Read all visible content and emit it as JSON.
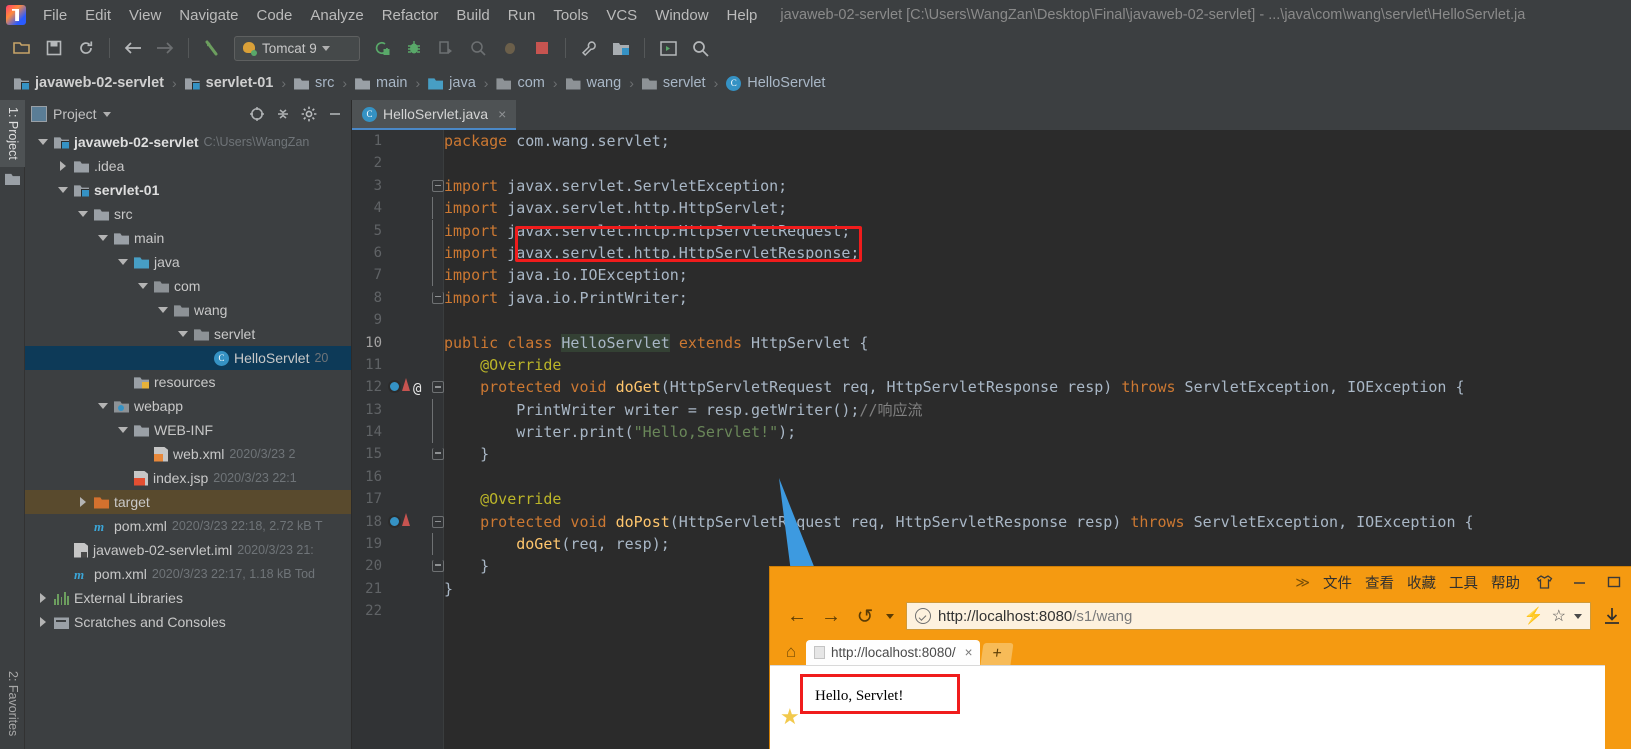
{
  "window": {
    "title": "javaweb-02-servlet [C:\\Users\\WangZan\\Desktop\\Final\\javaweb-02-servlet] - ...\\java\\com\\wang\\servlet\\HelloServlet.ja"
  },
  "menubar": {
    "items": [
      "File",
      "Edit",
      "View",
      "Navigate",
      "Code",
      "Analyze",
      "Refactor",
      "Build",
      "Run",
      "Tools",
      "VCS",
      "Window",
      "Help"
    ]
  },
  "toolbar": {
    "run_config": "Tomcat 9",
    "buttons": [
      "open-folder",
      "save-all",
      "sync",
      "back",
      "forward",
      "revert",
      "run",
      "debug",
      "run-with-coverage",
      "profile",
      "attach",
      "stop",
      "settings",
      "project-structure",
      "update",
      "search"
    ]
  },
  "breadcrumbs": [
    {
      "label": "javaweb-02-servlet",
      "icon": "module-icon",
      "bold": true
    },
    {
      "label": "servlet-01",
      "icon": "module-icon",
      "bold": true
    },
    {
      "label": "src",
      "icon": "folder-icon",
      "bold": false
    },
    {
      "label": "main",
      "icon": "folder-icon",
      "bold": false
    },
    {
      "label": "java",
      "icon": "source-folder-icon",
      "bold": false
    },
    {
      "label": "com",
      "icon": "package-icon",
      "bold": false
    },
    {
      "label": "wang",
      "icon": "package-icon",
      "bold": false
    },
    {
      "label": "servlet",
      "icon": "package-icon",
      "bold": false
    },
    {
      "label": "HelloServlet",
      "icon": "class-icon",
      "bold": false
    }
  ],
  "vertical_tabs": [
    {
      "label": "1: Project",
      "active": true
    },
    {
      "label": "2: Favorites",
      "active": false
    }
  ],
  "project_panel": {
    "title": "Project",
    "toolbar_icons": [
      "locate-icon",
      "collapse-all-icon",
      "gear-icon",
      "hide-icon"
    ],
    "tree": [
      {
        "indent": 0,
        "arrow": "down",
        "icon": "module-icon",
        "name": "javaweb-02-servlet",
        "meta": "C:\\Users\\WangZan",
        "bold": true,
        "state": ""
      },
      {
        "indent": 1,
        "arrow": "right",
        "icon": "folder-icon",
        "name": ".idea",
        "meta": "",
        "bold": false,
        "state": ""
      },
      {
        "indent": 1,
        "arrow": "down",
        "icon": "module-icon",
        "name": "servlet-01",
        "meta": "",
        "bold": true,
        "state": ""
      },
      {
        "indent": 2,
        "arrow": "down",
        "icon": "folder-icon",
        "name": "src",
        "meta": "",
        "bold": false,
        "state": ""
      },
      {
        "indent": 3,
        "arrow": "down",
        "icon": "folder-icon",
        "name": "main",
        "meta": "",
        "bold": false,
        "state": ""
      },
      {
        "indent": 4,
        "arrow": "down",
        "icon": "source-folder-icon",
        "name": "java",
        "meta": "",
        "bold": false,
        "state": ""
      },
      {
        "indent": 5,
        "arrow": "down",
        "icon": "package-icon",
        "name": "com",
        "meta": "",
        "bold": false,
        "state": ""
      },
      {
        "indent": 6,
        "arrow": "down",
        "icon": "package-icon",
        "name": "wang",
        "meta": "",
        "bold": false,
        "state": ""
      },
      {
        "indent": 7,
        "arrow": "down",
        "icon": "package-icon",
        "name": "servlet",
        "meta": "",
        "bold": false,
        "state": ""
      },
      {
        "indent": 8,
        "arrow": "none",
        "icon": "class-icon",
        "name": "HelloServlet",
        "meta": "20",
        "bold": false,
        "state": "selected"
      },
      {
        "indent": 4,
        "arrow": "none",
        "icon": "resources-icon",
        "name": "resources",
        "meta": "",
        "bold": false,
        "state": ""
      },
      {
        "indent": 3,
        "arrow": "down",
        "icon": "webapp-icon",
        "name": "webapp",
        "meta": "",
        "bold": false,
        "state": ""
      },
      {
        "indent": 4,
        "arrow": "down",
        "icon": "folder-icon",
        "name": "WEB-INF",
        "meta": "",
        "bold": false,
        "state": ""
      },
      {
        "indent": 5,
        "arrow": "none",
        "icon": "xml-icon",
        "name": "web.xml",
        "meta": "2020/3/23 2",
        "bold": false,
        "state": ""
      },
      {
        "indent": 4,
        "arrow": "none",
        "icon": "jsp-icon",
        "name": "index.jsp",
        "meta": "2020/3/23 22:1",
        "bold": false,
        "state": ""
      },
      {
        "indent": 2,
        "arrow": "right",
        "icon": "target-folder-icon",
        "name": "target",
        "meta": "",
        "bold": false,
        "state": "target-hl"
      },
      {
        "indent": 2,
        "arrow": "none",
        "icon": "maven-icon",
        "name": "pom.xml",
        "meta": "2020/3/23 22:18, 2.72 kB T",
        "bold": false,
        "state": ""
      },
      {
        "indent": 1,
        "arrow": "none",
        "icon": "iml-icon",
        "name": "javaweb-02-servlet.iml",
        "meta": "2020/3/23 21:",
        "bold": false,
        "state": ""
      },
      {
        "indent": 1,
        "arrow": "none",
        "icon": "maven-icon",
        "name": "pom.xml",
        "meta": "2020/3/23 22:17, 1.18 kB Tod",
        "bold": false,
        "state": ""
      },
      {
        "indent": 0,
        "arrow": "right",
        "icon": "library-icon",
        "name": "External Libraries",
        "meta": "",
        "bold": false,
        "state": ""
      },
      {
        "indent": 0,
        "arrow": "right",
        "icon": "scratch-icon",
        "name": "Scratches and Consoles",
        "meta": "",
        "bold": false,
        "state": ""
      }
    ]
  },
  "editor": {
    "tab": {
      "label": "HelloServlet.java",
      "icon": "class-icon",
      "close": "×"
    },
    "lines": [
      {
        "n": 1,
        "html": "<span class=\"kw\">package</span> com.wang.servlet;",
        "fold": "",
        "gutter": ""
      },
      {
        "n": 2,
        "html": "",
        "fold": "",
        "gutter": ""
      },
      {
        "n": 3,
        "html": "<span class=\"kw\">import</span> javax.servlet.ServletException;",
        "fold": "minus",
        "gutter": ""
      },
      {
        "n": 4,
        "html": "<span class=\"kw\">import</span> javax.servlet.http.HttpServlet;",
        "fold": "bar",
        "gutter": ""
      },
      {
        "n": 5,
        "html": "<span class=\"kw\">import</span> javax.servlet.http.HttpServletRequest;",
        "fold": "bar",
        "gutter": ""
      },
      {
        "n": 6,
        "html": "<span class=\"kw\">import</span> javax.servlet.http.HttpServletResponse;",
        "fold": "bar",
        "gutter": ""
      },
      {
        "n": 7,
        "html": "<span class=\"kw\">import</span> java.io.IOException;",
        "fold": "bar",
        "gutter": ""
      },
      {
        "n": 8,
        "html": "<span class=\"kw\">import</span> java.io.PrintWriter;",
        "fold": "end",
        "gutter": ""
      },
      {
        "n": 9,
        "html": "",
        "fold": "",
        "gutter": ""
      },
      {
        "n": 10,
        "html": "<span class=\"kw\">public class</span> <span class=\"hl-sel\">HelloServlet</span> <span class=\"kw\">extends</span> HttpServlet {",
        "fold": "",
        "gutter": ""
      },
      {
        "n": 11,
        "html": "    <span class=\"ann\">@Override</span>",
        "fold": "",
        "gutter": ""
      },
      {
        "n": 12,
        "html": "    <span class=\"kw\">protected void</span> <span class=\"mth\">doGet</span>(HttpServletRequest req, HttpServletResponse resp) <span class=\"kw\">throws</span> ServletException, IOException {",
        "fold": "minus",
        "gutter": "override-at"
      },
      {
        "n": 13,
        "html": "        PrintWriter writer = resp.getWriter();<span class=\"cmt\">//响应流</span>",
        "fold": "bar",
        "gutter": ""
      },
      {
        "n": 14,
        "html": "        writer.print(<span class=\"str\">\"Hello,Servlet!\"</span>);",
        "fold": "bar",
        "gutter": ""
      },
      {
        "n": 15,
        "html": "    }",
        "fold": "end",
        "gutter": ""
      },
      {
        "n": 16,
        "html": "",
        "fold": "",
        "gutter": ""
      },
      {
        "n": 17,
        "html": "    <span class=\"ann\">@Override</span>",
        "fold": "",
        "gutter": ""
      },
      {
        "n": 18,
        "html": "    <span class=\"kw\">protected void</span> <span class=\"mth\">doPost</span>(HttpServletRequest req, HttpServletResponse resp) <span class=\"kw\">throws</span> ServletException, IOException {",
        "fold": "minus",
        "gutter": "override"
      },
      {
        "n": 19,
        "html": "        <span class=\"mth\">doGet</span>(req, resp);",
        "fold": "bar",
        "gutter": ""
      },
      {
        "n": 20,
        "html": "    }",
        "fold": "end",
        "gutter": ""
      },
      {
        "n": 21,
        "html": "}",
        "fold": "",
        "gutter": ""
      },
      {
        "n": 22,
        "html": "",
        "fold": "",
        "gutter": ""
      }
    ]
  },
  "annotations": {
    "highlight_color": "#f01c1c",
    "arrow_color": "#3d9ae0"
  },
  "browser": {
    "menu_items": [
      "文件",
      "查看",
      "收藏",
      "工具",
      "帮助"
    ],
    "chevron": "≫",
    "window_buttons": [
      "skin-icon",
      "minimize-icon",
      "maximize-icon"
    ],
    "nav": {
      "back": "←",
      "forward": "→",
      "reload": "↺"
    },
    "url_prefix": "http://localhost:8080",
    "url_path": "/s1/wang",
    "url_full": "http://localhost:8080/s1/wang",
    "url_right_icons": [
      "lightning-icon",
      "star-icon",
      "chevron-down-icon",
      "download-icon"
    ],
    "tab": {
      "title": "http://localhost:8080/",
      "close": "×"
    },
    "new_tab": "+",
    "home": "⌂",
    "page_content": "Hello, Servlet!"
  }
}
